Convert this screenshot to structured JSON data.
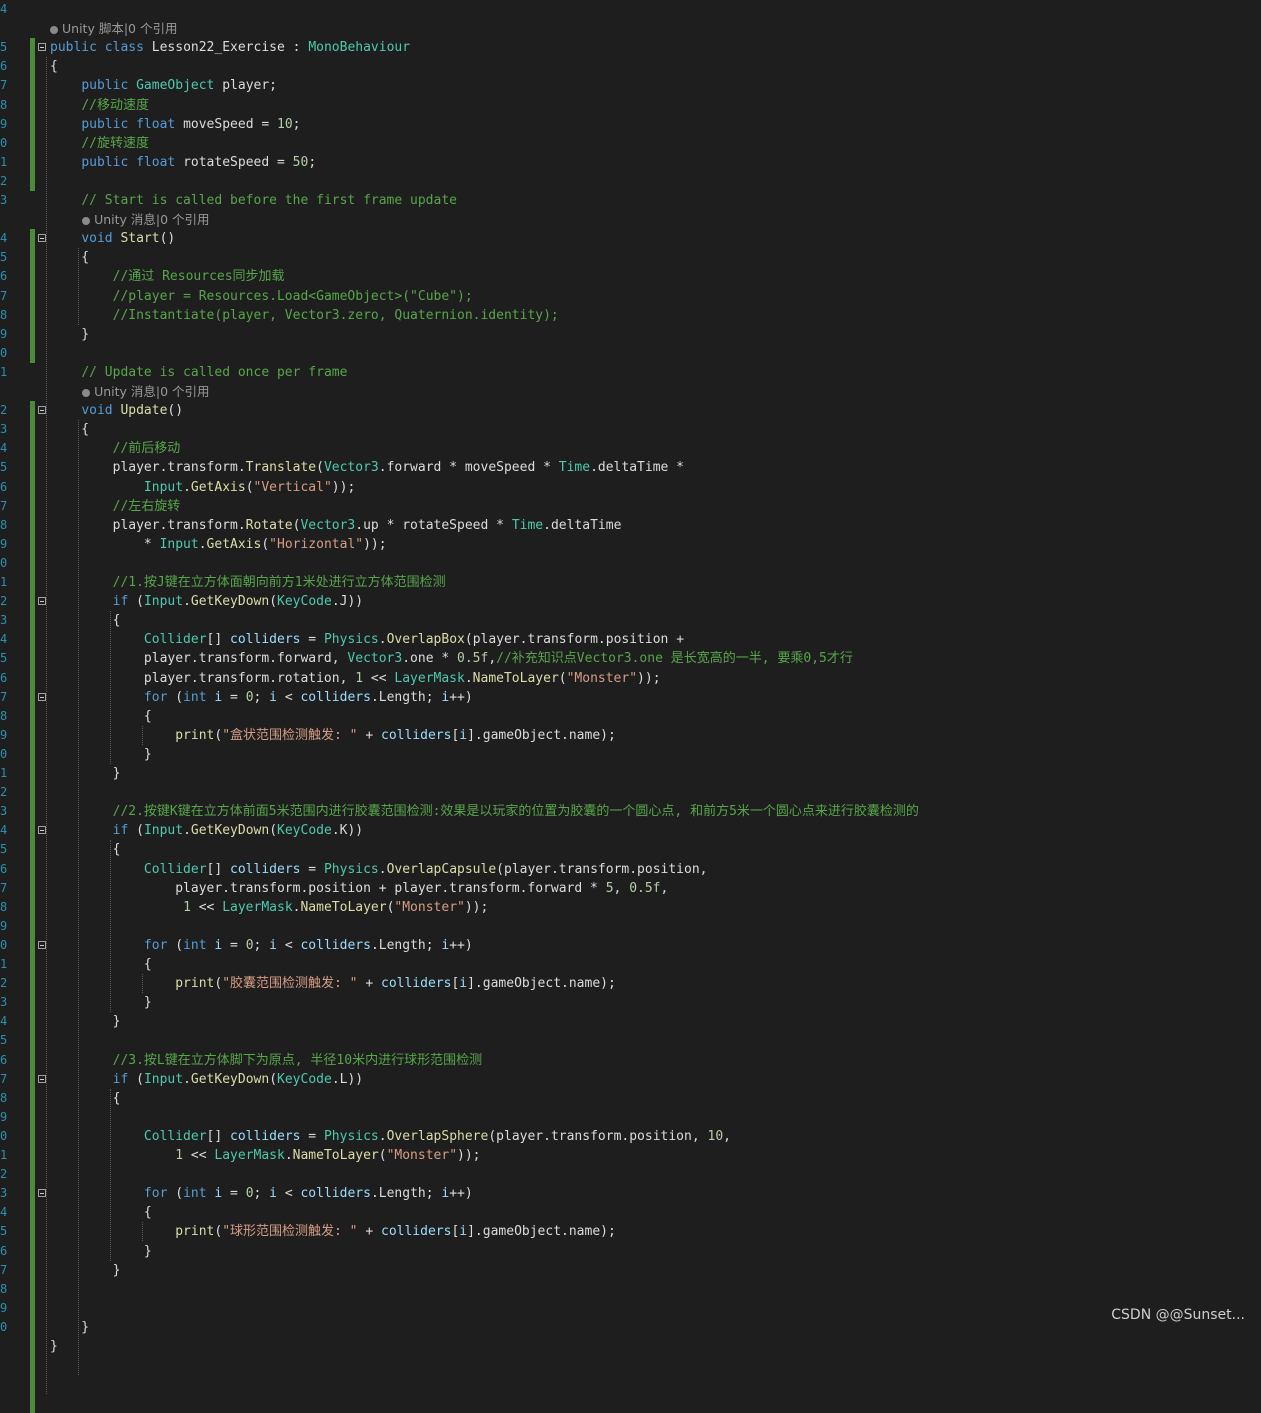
{
  "editor": {
    "lines": [
      {
        "n": "4",
        "code": []
      },
      {
        "n": "",
        "lens": "Unity 脚本|0 个引用"
      },
      {
        "n": "5",
        "fold": true,
        "code": [
          [
            "public",
            "k"
          ],
          [
            " "
          ],
          [
            "class",
            "k"
          ],
          [
            " Lesson22_Exercise : "
          ],
          [
            "MonoBehaviour",
            "t"
          ]
        ]
      },
      {
        "n": "6",
        "code": [
          [
            "{"
          ]
        ]
      },
      {
        "n": "7",
        "code": [
          [
            "    "
          ],
          [
            "public",
            "k"
          ],
          [
            " "
          ],
          [
            "GameObject",
            "t"
          ],
          [
            " player;"
          ]
        ]
      },
      {
        "n": "8",
        "code": [
          [
            "    "
          ],
          [
            "//移动速度",
            "c"
          ]
        ]
      },
      {
        "n": "9",
        "code": [
          [
            "    "
          ],
          [
            "public",
            "k"
          ],
          [
            " "
          ],
          [
            "float",
            "k"
          ],
          [
            " moveSpeed = "
          ],
          [
            "10",
            "n"
          ],
          [
            ";"
          ]
        ]
      },
      {
        "n": "0",
        "code": [
          [
            "    "
          ],
          [
            "//旋转速度",
            "c"
          ]
        ]
      },
      {
        "n": "1",
        "code": [
          [
            "    "
          ],
          [
            "public",
            "k"
          ],
          [
            " "
          ],
          [
            "float",
            "k"
          ],
          [
            " rotateSpeed = "
          ],
          [
            "50",
            "n"
          ],
          [
            ";"
          ]
        ]
      },
      {
        "n": "2",
        "code": []
      },
      {
        "n": "3",
        "code": [
          [
            "    "
          ],
          [
            "// Start is called before the first frame update",
            "c"
          ]
        ]
      },
      {
        "n": "",
        "lens": "Unity 消息|0 个引用",
        "indent": 4
      },
      {
        "n": "4",
        "fold": true,
        "code": [
          [
            "    "
          ],
          [
            "void",
            "k"
          ],
          [
            " "
          ],
          [
            "Start",
            "m"
          ],
          [
            "()"
          ]
        ]
      },
      {
        "n": "5",
        "code": [
          [
            "    {"
          ]
        ]
      },
      {
        "n": "6",
        "code": [
          [
            "        "
          ],
          [
            "//通过 Resources同步加载",
            "c"
          ]
        ]
      },
      {
        "n": "7",
        "code": [
          [
            "        "
          ],
          [
            "//player = Resources.Load<GameObject>(\"Cube\");",
            "c"
          ]
        ]
      },
      {
        "n": "8",
        "code": [
          [
            "        "
          ],
          [
            "//Instantiate(player, Vector3.zero, Quaternion.identity);",
            "c"
          ]
        ]
      },
      {
        "n": "9",
        "code": [
          [
            "    }"
          ]
        ]
      },
      {
        "n": "0",
        "code": []
      },
      {
        "n": "1",
        "code": [
          [
            "    "
          ],
          [
            "// Update is called once per frame",
            "c"
          ]
        ]
      },
      {
        "n": "",
        "lens": "Unity 消息|0 个引用",
        "indent": 4
      },
      {
        "n": "2",
        "fold": true,
        "code": [
          [
            "    "
          ],
          [
            "void",
            "k"
          ],
          [
            " "
          ],
          [
            "Update",
            "m"
          ],
          [
            "()"
          ]
        ]
      },
      {
        "n": "3",
        "code": [
          [
            "    {"
          ]
        ]
      },
      {
        "n": "4",
        "code": [
          [
            "        "
          ],
          [
            "//前后移动",
            "c"
          ]
        ]
      },
      {
        "n": "5",
        "code": [
          [
            "        player.transform."
          ],
          [
            "Translate",
            "m"
          ],
          [
            "("
          ],
          [
            "Vector3",
            "t"
          ],
          [
            ".forward * moveSpeed * "
          ],
          [
            "Time",
            "t"
          ],
          [
            ".deltaTime *"
          ]
        ]
      },
      {
        "n": "6",
        "code": [
          [
            "            "
          ],
          [
            "Input",
            "t"
          ],
          [
            "."
          ],
          [
            "GetAxis",
            "m"
          ],
          [
            "("
          ],
          [
            "\"Vertical\"",
            "s"
          ],
          [
            "));"
          ]
        ]
      },
      {
        "n": "7",
        "code": [
          [
            "        "
          ],
          [
            "//左右旋转",
            "c"
          ]
        ]
      },
      {
        "n": "8",
        "code": [
          [
            "        player.transform."
          ],
          [
            "Rotate",
            "m"
          ],
          [
            "("
          ],
          [
            "Vector3",
            "t"
          ],
          [
            ".up * rotateSpeed * "
          ],
          [
            "Time",
            "t"
          ],
          [
            ".deltaTime"
          ]
        ]
      },
      {
        "n": "9",
        "code": [
          [
            "            * "
          ],
          [
            "Input",
            "t"
          ],
          [
            "."
          ],
          [
            "GetAxis",
            "m"
          ],
          [
            "("
          ],
          [
            "\"Horizontal\"",
            "s"
          ],
          [
            "));"
          ]
        ]
      },
      {
        "n": "0",
        "code": []
      },
      {
        "n": "1",
        "code": [
          [
            "        "
          ],
          [
            "//1.按J键在立方体面朝向前方1米处进行立方体范围检测",
            "c"
          ]
        ]
      },
      {
        "n": "2",
        "fold": true,
        "code": [
          [
            "        "
          ],
          [
            "if",
            "k"
          ],
          [
            " ("
          ],
          [
            "Input",
            "t"
          ],
          [
            "."
          ],
          [
            "GetKeyDown",
            "m"
          ],
          [
            "("
          ],
          [
            "KeyCode",
            "t"
          ],
          [
            ".J))"
          ]
        ]
      },
      {
        "n": "3",
        "code": [
          [
            "        {"
          ]
        ]
      },
      {
        "n": "4",
        "code": [
          [
            "            "
          ],
          [
            "Collider",
            "t"
          ],
          [
            "[] "
          ],
          [
            "colliders",
            "v"
          ],
          [
            " = "
          ],
          [
            "Physics",
            "t"
          ],
          [
            "."
          ],
          [
            "OverlapBox",
            "m"
          ],
          [
            "(player.transform.position +"
          ]
        ]
      },
      {
        "n": "5",
        "code": [
          [
            "            player.transform.forward, "
          ],
          [
            "Vector3",
            "t"
          ],
          [
            ".one * "
          ],
          [
            "0.5f",
            "n"
          ],
          [
            ","
          ],
          [
            "//补充知识点Vector3.one 是长宽高的一半, 要乘0,5才行",
            "c"
          ]
        ]
      },
      {
        "n": "6",
        "code": [
          [
            "            player.transform.rotation, "
          ],
          [
            "1",
            "n"
          ],
          [
            " << "
          ],
          [
            "LayerMask",
            "t"
          ],
          [
            "."
          ],
          [
            "NameToLayer",
            "m"
          ],
          [
            "("
          ],
          [
            "\"Monster\"",
            "s"
          ],
          [
            "));"
          ]
        ]
      },
      {
        "n": "7",
        "fold": true,
        "code": [
          [
            "            "
          ],
          [
            "for",
            "k"
          ],
          [
            " ("
          ],
          [
            "int",
            "k"
          ],
          [
            " "
          ],
          [
            "i",
            "v"
          ],
          [
            " = "
          ],
          [
            "0",
            "n"
          ],
          [
            "; "
          ],
          [
            "i",
            "v"
          ],
          [
            " < "
          ],
          [
            "colliders",
            "v"
          ],
          [
            ".Length; "
          ],
          [
            "i",
            "v"
          ],
          [
            "++)"
          ]
        ]
      },
      {
        "n": "8",
        "code": [
          [
            "            {"
          ]
        ]
      },
      {
        "n": "9",
        "code": [
          [
            "                "
          ],
          [
            "print",
            "m"
          ],
          [
            "("
          ],
          [
            "\"盒状范围检测触发: \"",
            "s"
          ],
          [
            " + "
          ],
          [
            "colliders",
            "v"
          ],
          [
            "["
          ],
          [
            "i",
            "v"
          ],
          [
            "].gameObject.name);"
          ]
        ]
      },
      {
        "n": "0",
        "code": [
          [
            "            }"
          ]
        ]
      },
      {
        "n": "1",
        "code": [
          [
            "        }"
          ]
        ]
      },
      {
        "n": "2",
        "code": []
      },
      {
        "n": "3",
        "code": [
          [
            "        "
          ],
          [
            "//2.按键K键在立方体前面5米范围内进行胶囊范围检测:效果是以玩家的位置为胶囊的一个圆心点, 和前方5米一个圆心点来进行胶囊检测的",
            "c"
          ]
        ]
      },
      {
        "n": "4",
        "fold": true,
        "code": [
          [
            "        "
          ],
          [
            "if",
            "k"
          ],
          [
            " ("
          ],
          [
            "Input",
            "t"
          ],
          [
            "."
          ],
          [
            "GetKeyDown",
            "m"
          ],
          [
            "("
          ],
          [
            "KeyCode",
            "t"
          ],
          [
            ".K))"
          ]
        ]
      },
      {
        "n": "5",
        "code": [
          [
            "        {"
          ]
        ]
      },
      {
        "n": "6",
        "code": [
          [
            "            "
          ],
          [
            "Collider",
            "t"
          ],
          [
            "[] "
          ],
          [
            "colliders",
            "v"
          ],
          [
            " = "
          ],
          [
            "Physics",
            "t"
          ],
          [
            "."
          ],
          [
            "OverlapCapsule",
            "m"
          ],
          [
            "(player.transform.position,"
          ]
        ]
      },
      {
        "n": "7",
        "code": [
          [
            "                player.transform.position + player.transform.forward * "
          ],
          [
            "5",
            "n"
          ],
          [
            ", "
          ],
          [
            "0.5f",
            "n"
          ],
          [
            ","
          ]
        ]
      },
      {
        "n": "8",
        "code": [
          [
            "                 "
          ],
          [
            "1",
            "n"
          ],
          [
            " << "
          ],
          [
            "LayerMask",
            "t"
          ],
          [
            "."
          ],
          [
            "NameToLayer",
            "m"
          ],
          [
            "("
          ],
          [
            "\"Monster\"",
            "s"
          ],
          [
            "));"
          ]
        ]
      },
      {
        "n": "9",
        "code": []
      },
      {
        "n": "0",
        "fold": true,
        "code": [
          [
            "            "
          ],
          [
            "for",
            "k"
          ],
          [
            " ("
          ],
          [
            "int",
            "k"
          ],
          [
            " "
          ],
          [
            "i",
            "v"
          ],
          [
            " = "
          ],
          [
            "0",
            "n"
          ],
          [
            "; "
          ],
          [
            "i",
            "v"
          ],
          [
            " < "
          ],
          [
            "colliders",
            "v"
          ],
          [
            ".Length; "
          ],
          [
            "i",
            "v"
          ],
          [
            "++)"
          ]
        ]
      },
      {
        "n": "1",
        "code": [
          [
            "            {"
          ]
        ]
      },
      {
        "n": "2",
        "code": [
          [
            "                "
          ],
          [
            "print",
            "m"
          ],
          [
            "("
          ],
          [
            "\"胶囊范围检测触发: \"",
            "s"
          ],
          [
            " + "
          ],
          [
            "colliders",
            "v"
          ],
          [
            "["
          ],
          [
            "i",
            "v"
          ],
          [
            "].gameObject.name);"
          ]
        ]
      },
      {
        "n": "3",
        "code": [
          [
            "            }"
          ]
        ]
      },
      {
        "n": "4",
        "code": [
          [
            "        }"
          ]
        ]
      },
      {
        "n": "5",
        "code": []
      },
      {
        "n": "6",
        "code": [
          [
            "        "
          ],
          [
            "//3.按L键在立方体脚下为原点, 半径10米内进行球形范围检测",
            "c"
          ]
        ]
      },
      {
        "n": "7",
        "fold": true,
        "code": [
          [
            "        "
          ],
          [
            "if",
            "k"
          ],
          [
            " ("
          ],
          [
            "Input",
            "t"
          ],
          [
            "."
          ],
          [
            "GetKeyDown",
            "m"
          ],
          [
            "("
          ],
          [
            "KeyCode",
            "t"
          ],
          [
            ".L))"
          ]
        ]
      },
      {
        "n": "8",
        "code": [
          [
            "        {"
          ]
        ]
      },
      {
        "n": "9",
        "code": []
      },
      {
        "n": "0",
        "code": [
          [
            "            "
          ],
          [
            "Collider",
            "t"
          ],
          [
            "[] "
          ],
          [
            "colliders",
            "v"
          ],
          [
            " = "
          ],
          [
            "Physics",
            "t"
          ],
          [
            "."
          ],
          [
            "OverlapSphere",
            "m"
          ],
          [
            "(player.transform.position, "
          ],
          [
            "10",
            "n"
          ],
          [
            ","
          ]
        ]
      },
      {
        "n": "1",
        "code": [
          [
            "                "
          ],
          [
            "1",
            "n"
          ],
          [
            " << "
          ],
          [
            "LayerMask",
            "t"
          ],
          [
            "."
          ],
          [
            "NameToLayer",
            "m"
          ],
          [
            "("
          ],
          [
            "\"Monster\"",
            "s"
          ],
          [
            "));"
          ]
        ]
      },
      {
        "n": "2",
        "code": []
      },
      {
        "n": "3",
        "fold": true,
        "code": [
          [
            "            "
          ],
          [
            "for",
            "k"
          ],
          [
            " ("
          ],
          [
            "int",
            "k"
          ],
          [
            " "
          ],
          [
            "i",
            "v"
          ],
          [
            " = "
          ],
          [
            "0",
            "n"
          ],
          [
            "; "
          ],
          [
            "i",
            "v"
          ],
          [
            " < "
          ],
          [
            "colliders",
            "v"
          ],
          [
            ".Length; "
          ],
          [
            "i",
            "v"
          ],
          [
            "++)"
          ]
        ]
      },
      {
        "n": "4",
        "code": [
          [
            "            {"
          ]
        ]
      },
      {
        "n": "5",
        "code": [
          [
            "                "
          ],
          [
            "print",
            "m"
          ],
          [
            "("
          ],
          [
            "\"球形范围检测触发: \"",
            "s"
          ],
          [
            " + "
          ],
          [
            "colliders",
            "v"
          ],
          [
            "["
          ],
          [
            "i",
            "v"
          ],
          [
            "].gameObject.name);"
          ]
        ]
      },
      {
        "n": "6",
        "code": [
          [
            "            }"
          ]
        ]
      },
      {
        "n": "7",
        "code": [
          [
            "        }"
          ]
        ]
      },
      {
        "n": "8",
        "code": []
      },
      {
        "n": "9",
        "code": []
      },
      {
        "n": "0",
        "code": [
          [
            "    }"
          ]
        ]
      },
      {
        "n": "",
        "code": [
          [
            "}"
          ]
        ]
      }
    ]
  },
  "watermark": "CSDN @@Sunset..."
}
